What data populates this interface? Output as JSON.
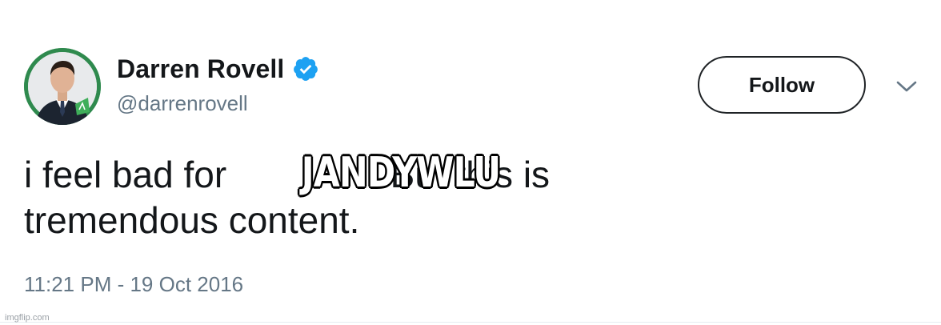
{
  "user": {
    "display_name": "Darren Rovell",
    "handle": "@darrenrovell",
    "verified": true
  },
  "actions": {
    "follow_label": "Follow",
    "menu_icon": "chevron-down-icon"
  },
  "tweet": {
    "line1": "i feel bad for              . But this is",
    "line2": "tremendous content.",
    "timestamp": "11:21 PM - 19 Oct 2016"
  },
  "overlay": {
    "caption": "JANDYWLU"
  },
  "watermark": "imgflip.com",
  "colors": {
    "text_primary": "#14171a",
    "text_secondary": "#657786",
    "verified_blue": "#1da1f2",
    "avatar_green": "#2f8a4e",
    "divider": "#e6ecf0"
  }
}
